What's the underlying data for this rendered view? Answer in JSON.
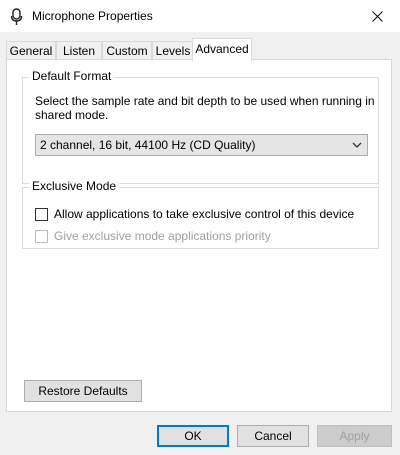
{
  "window": {
    "title": "Microphone Properties",
    "icon": "microphone-icon",
    "close_icon": "close-icon"
  },
  "tabs": [
    {
      "label": "General"
    },
    {
      "label": "Listen"
    },
    {
      "label": "Custom"
    },
    {
      "label": "Levels"
    },
    {
      "label": "Advanced",
      "active": true
    }
  ],
  "default_format": {
    "title": "Default Format",
    "description": "Select the sample rate and bit depth to be used when running in shared mode.",
    "selected": "2 channel, 16 bit, 44100 Hz (CD Quality)"
  },
  "exclusive_mode": {
    "title": "Exclusive Mode",
    "allow_label": "Allow applications to take exclusive control of this device",
    "allow_checked": false,
    "priority_label": "Give exclusive mode applications priority",
    "priority_checked": false,
    "priority_enabled": false
  },
  "buttons": {
    "restore": "Restore Defaults",
    "ok": "OK",
    "cancel": "Cancel",
    "apply": "Apply"
  },
  "colors": {
    "accent": "#0078d7",
    "disabled_text": "#a0a0a0"
  }
}
